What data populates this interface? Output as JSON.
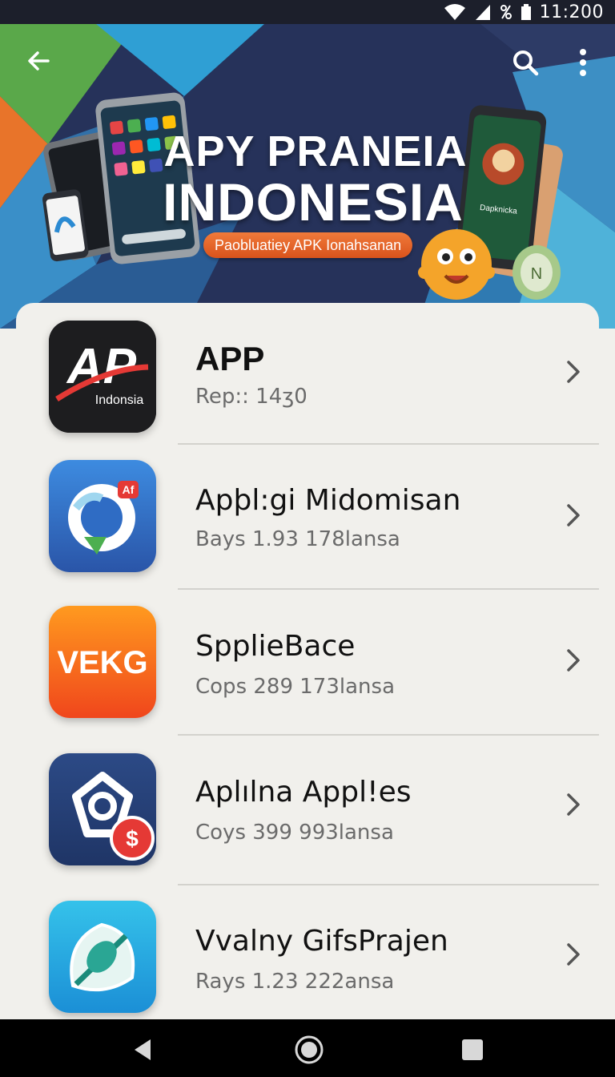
{
  "status_bar": {
    "time": "11:200"
  },
  "banner": {
    "title_line1": "APY PRANEIA",
    "title_line2": "INDONESIA",
    "pill_text": "Paobluatiey APK Ionahsanan",
    "phone_screen_text": "Dapknicka",
    "tablet_label": "N"
  },
  "apps": [
    {
      "name": "APP",
      "meta": "Rep:: 14ʒ0",
      "icon_text": "Indonsia",
      "icon_mark": "AP"
    },
    {
      "name": "Apþl:gi Midomisan",
      "meta": "Bays 1.93  178lansa",
      "icon_badge": "Af"
    },
    {
      "name": "SpplieBace",
      "meta": "Cops 289  173lansa",
      "icon_text": "VEKG"
    },
    {
      "name": "Aplılna Appl!es",
      "meta": "Coys 399  993lansa",
      "icon_badge": "$"
    },
    {
      "name": "Vvalny GifsPrajen",
      "meta": "Rays 1.23  222ansa"
    }
  ]
}
